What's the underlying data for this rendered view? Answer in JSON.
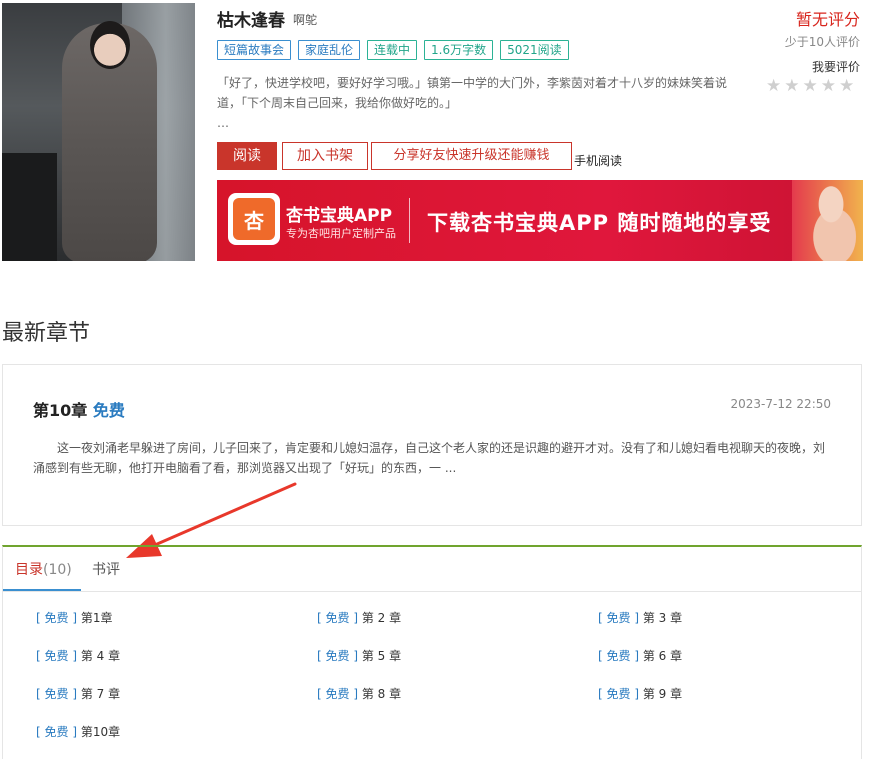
{
  "book": {
    "title": "枯木逢春",
    "author": "啊鸵",
    "tags": [
      "短篇故事会",
      "家庭乱伦",
      "连载中",
      "1.6万字数",
      "5021阅读"
    ],
    "description": "「好了，快进学校吧，要好好学习哦。」镇第一中学的大门外，李紫茵对着才十八岁的妹妹笑着说道，「下个周末自己回来，我给你做好吃的。」",
    "ellipsis": "…"
  },
  "actions": {
    "read": "阅读",
    "add_shelf": "加入书架",
    "share": "分享好友快速升级还能赚钱",
    "mobile_read": "手机阅读"
  },
  "rating": {
    "status": "暂无评分",
    "raters": "少于10人评价",
    "rate_link": "我要评价",
    "stars_filled": 0,
    "stars_total": 5
  },
  "banner": {
    "logo_char": "杏",
    "app_name": "杏书宝典APP",
    "app_sub": "专为杏吧用户定制产品",
    "slogan": "下载杏书宝典APP 随时随地的享受"
  },
  "latest": {
    "heading": "最新章节",
    "chapter_title": "第10章",
    "free_label": "免费",
    "date": "2023-7-12 22:50",
    "excerpt": "这一夜刘涌老早躲进了房间，儿子回来了，肯定要和儿媳妇温存，自己这个老人家的还是识趣的避开才对。没有了和儿媳妇看电视聊天的夜晚，刘涌感到有些无聊，他打开电脑看了看，那浏览器又出现了「好玩」的东西，一 ..."
  },
  "tabs": {
    "toc_label": "目录",
    "toc_count": "(10)",
    "review_label": "书评"
  },
  "toc": {
    "items": [
      {
        "free": "免费",
        "title": "第1章"
      },
      {
        "free": "免费",
        "title": "第 2 章"
      },
      {
        "free": "免费",
        "title": "第 3 章"
      },
      {
        "free": "免费",
        "title": "第 4 章"
      },
      {
        "free": "免费",
        "title": "第 5 章"
      },
      {
        "free": "免费",
        "title": "第 6 章"
      },
      {
        "free": "免费",
        "title": "第 7 章"
      },
      {
        "free": "免费",
        "title": "第 8 章"
      },
      {
        "free": "免费",
        "title": "第 9 章"
      },
      {
        "free": "免费",
        "title": "第10章"
      }
    ]
  },
  "colors": {
    "accent_red": "#c9352b",
    "rating_red": "#d8261e",
    "link_blue": "#2a7bc0",
    "tag_teal": "#21a58a",
    "tab_border_green": "#70a42e"
  },
  "icons": {
    "star": "star-icon",
    "arrow": "annotation-arrow-icon"
  }
}
